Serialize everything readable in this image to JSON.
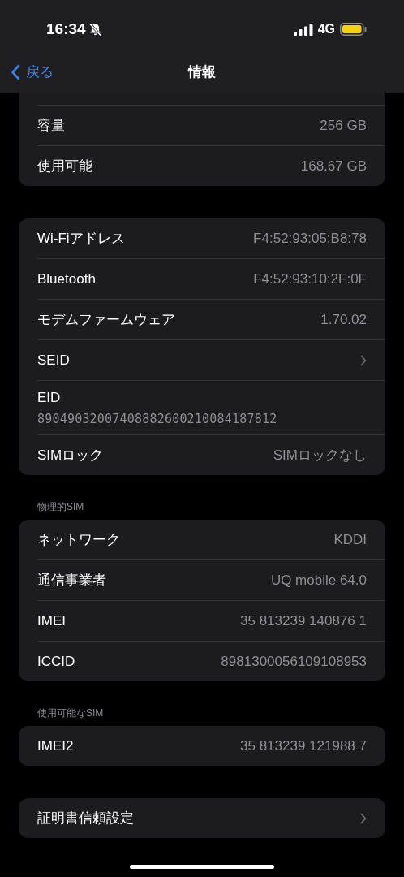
{
  "status_bar": {
    "time": "16:34",
    "network": "4G"
  },
  "nav": {
    "back": "戻る",
    "title": "情報"
  },
  "sections": [
    {
      "partial": true,
      "rows": [
        {
          "kind": "value",
          "label": "容量",
          "value": "256 GB"
        },
        {
          "kind": "value",
          "label": "使用可能",
          "value": "168.67 GB"
        }
      ]
    },
    {
      "rows": [
        {
          "kind": "value",
          "label": "Wi-Fiアドレス",
          "value": "F4:52:93:05:B8:78"
        },
        {
          "kind": "value",
          "label": "Bluetooth",
          "value": "F4:52:93:10:2F:0F"
        },
        {
          "kind": "value",
          "label": "モデムファームウェア",
          "value": "1.70.02"
        },
        {
          "kind": "chevron",
          "label": "SEID"
        },
        {
          "kind": "stacked",
          "label": "EID",
          "value": "89049032007408882600210084187812"
        },
        {
          "kind": "value",
          "label": "SIMロック",
          "value": "SIMロックなし"
        }
      ]
    },
    {
      "header": "物理的SIM",
      "rows": [
        {
          "kind": "value",
          "label": "ネットワーク",
          "value": "KDDI"
        },
        {
          "kind": "value",
          "label": "通信事業者",
          "value": "UQ mobile 64.0"
        },
        {
          "kind": "value",
          "label": "IMEI",
          "value": "35 813239 140876 1"
        },
        {
          "kind": "value",
          "label": "ICCID",
          "value": "8981300056109108953"
        }
      ]
    },
    {
      "header": "使用可能なSIM",
      "rows": [
        {
          "kind": "value",
          "label": "IMEI2",
          "value": "35 813239 121988 7"
        }
      ]
    },
    {
      "rows": [
        {
          "kind": "chevron",
          "label": "証明書信頼設定"
        }
      ]
    }
  ]
}
